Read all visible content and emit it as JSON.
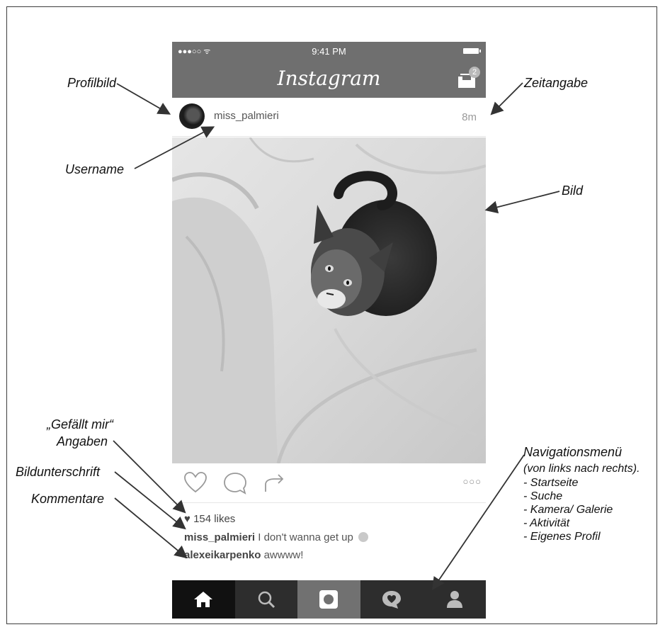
{
  "status_bar": {
    "signal": "●●●○○ ᯤ",
    "time": "9:41 PM"
  },
  "nav": {
    "logo": "Instagram",
    "inbox_badge": "2"
  },
  "post": {
    "username": "miss_palmieri",
    "time_ago": "8m",
    "likes": "154 likes",
    "caption_user": "miss_palmieri",
    "caption_text": "I don't wanna get up",
    "comment_user": "alexeikarpenko",
    "comment_text": "awwww!"
  },
  "annotations": {
    "profilbild": "Profilbild",
    "username": "Username",
    "zeitangabe": "Zeitangabe",
    "bild": "Bild",
    "gefaellt_line1": "„Gefällt mir“",
    "gefaellt_line2": "Angaben",
    "bildunterschrift": "Bildunterschrift",
    "kommentare": "Kommentare",
    "navigation_title": "Navigationsmenü",
    "navigation_sub": "(von links nach rechts).",
    "navigation_items": [
      "- Startseite",
      "- Suche",
      "- Kamera/ Galerie",
      "- Aktivität",
      "- Eigenes Profil"
    ]
  },
  "icons": {
    "tabs": [
      "home-icon",
      "search-icon",
      "camera-icon",
      "activity-icon",
      "profile-icon"
    ],
    "actions": [
      "heart-icon",
      "comment-icon",
      "share-icon",
      "more-icon"
    ]
  },
  "colors": {
    "bar": "#6f6f6f",
    "tabbar": "#2d2d2d",
    "tab_active": "#111111"
  }
}
